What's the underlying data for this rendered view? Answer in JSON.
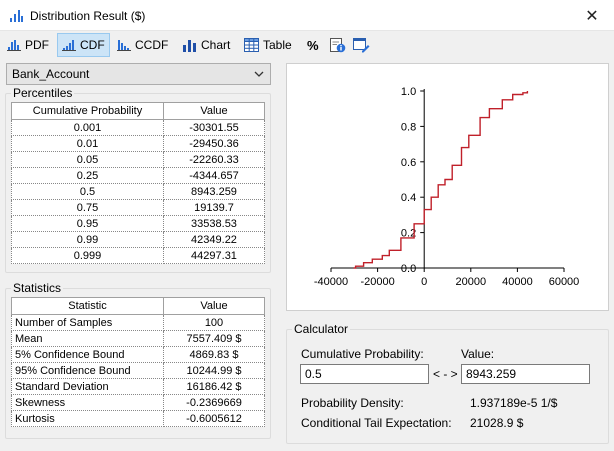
{
  "window": {
    "title": "Distribution Result ($)",
    "close_glyph": "✕"
  },
  "toolbar": {
    "pdf": "PDF",
    "cdf": "CDF",
    "ccdf": "CCDF",
    "chart": "Chart",
    "table": "Table",
    "percent": "%",
    "active": "cdf"
  },
  "variable": {
    "selected": "Bank_Account"
  },
  "percentiles": {
    "title": "Percentiles",
    "headers": [
      "Cumulative Probability",
      "Value"
    ],
    "rows": [
      [
        "0.001",
        "-30301.55"
      ],
      [
        "0.01",
        "-29450.36"
      ],
      [
        "0.05",
        "-22260.33"
      ],
      [
        "0.25",
        "-4344.657"
      ],
      [
        "0.5",
        "8943.259"
      ],
      [
        "0.75",
        "19139.7"
      ],
      [
        "0.95",
        "33538.53"
      ],
      [
        "0.99",
        "42349.22"
      ],
      [
        "0.999",
        "44297.31"
      ]
    ]
  },
  "statistics": {
    "title": "Statistics",
    "headers": [
      "Statistic",
      "Value"
    ],
    "rows": [
      [
        "Number of Samples",
        "100"
      ],
      [
        "Mean",
        "7557.409 $"
      ],
      [
        "5% Confidence Bound",
        "4869.83 $"
      ],
      [
        "95% Confidence Bound",
        "10244.99 $"
      ],
      [
        "Standard Deviation",
        "16186.42 $"
      ],
      [
        "Skewness",
        "-0.2369669"
      ],
      [
        "Kurtosis",
        "-0.6005612"
      ]
    ]
  },
  "calculator": {
    "title": "Calculator",
    "prob_label": "Cumulative Probability:",
    "value_label": "Value:",
    "prob_value": "0.5",
    "value_value": "8943.259",
    "arrow": "< - >",
    "density_label": "Probability Density:",
    "density_value": "1.937189e-5 1/$",
    "cte_label": "Conditional Tail Expectation:",
    "cte_value": "21028.9 $"
  },
  "chart_data": {
    "type": "line",
    "title": "",
    "xlabel": "",
    "ylabel": "",
    "xlim": [
      -40000,
      60000
    ],
    "ylim": [
      0,
      1.0
    ],
    "xticks": [
      "-40000",
      "-20000",
      "0",
      "20000",
      "40000",
      "60000"
    ],
    "yticks": [
      "0.0",
      "0.2",
      "0.4",
      "0.6",
      "0.8",
      "1.0"
    ],
    "line_color": "#c0202a",
    "series": [
      {
        "x": [
          -30302,
          -29450,
          -26000,
          -22260,
          -18000,
          -15000,
          -10000,
          -4345,
          0,
          3000,
          6000,
          8943,
          12000,
          16000,
          19140,
          24000,
          28000,
          33539,
          38000,
          42349,
          44297
        ],
        "y": [
          0.0,
          0.01,
          0.03,
          0.05,
          0.07,
          0.1,
          0.17,
          0.25,
          0.33,
          0.4,
          0.47,
          0.5,
          0.58,
          0.68,
          0.75,
          0.85,
          0.9,
          0.95,
          0.98,
          0.99,
          1.0
        ]
      }
    ]
  }
}
